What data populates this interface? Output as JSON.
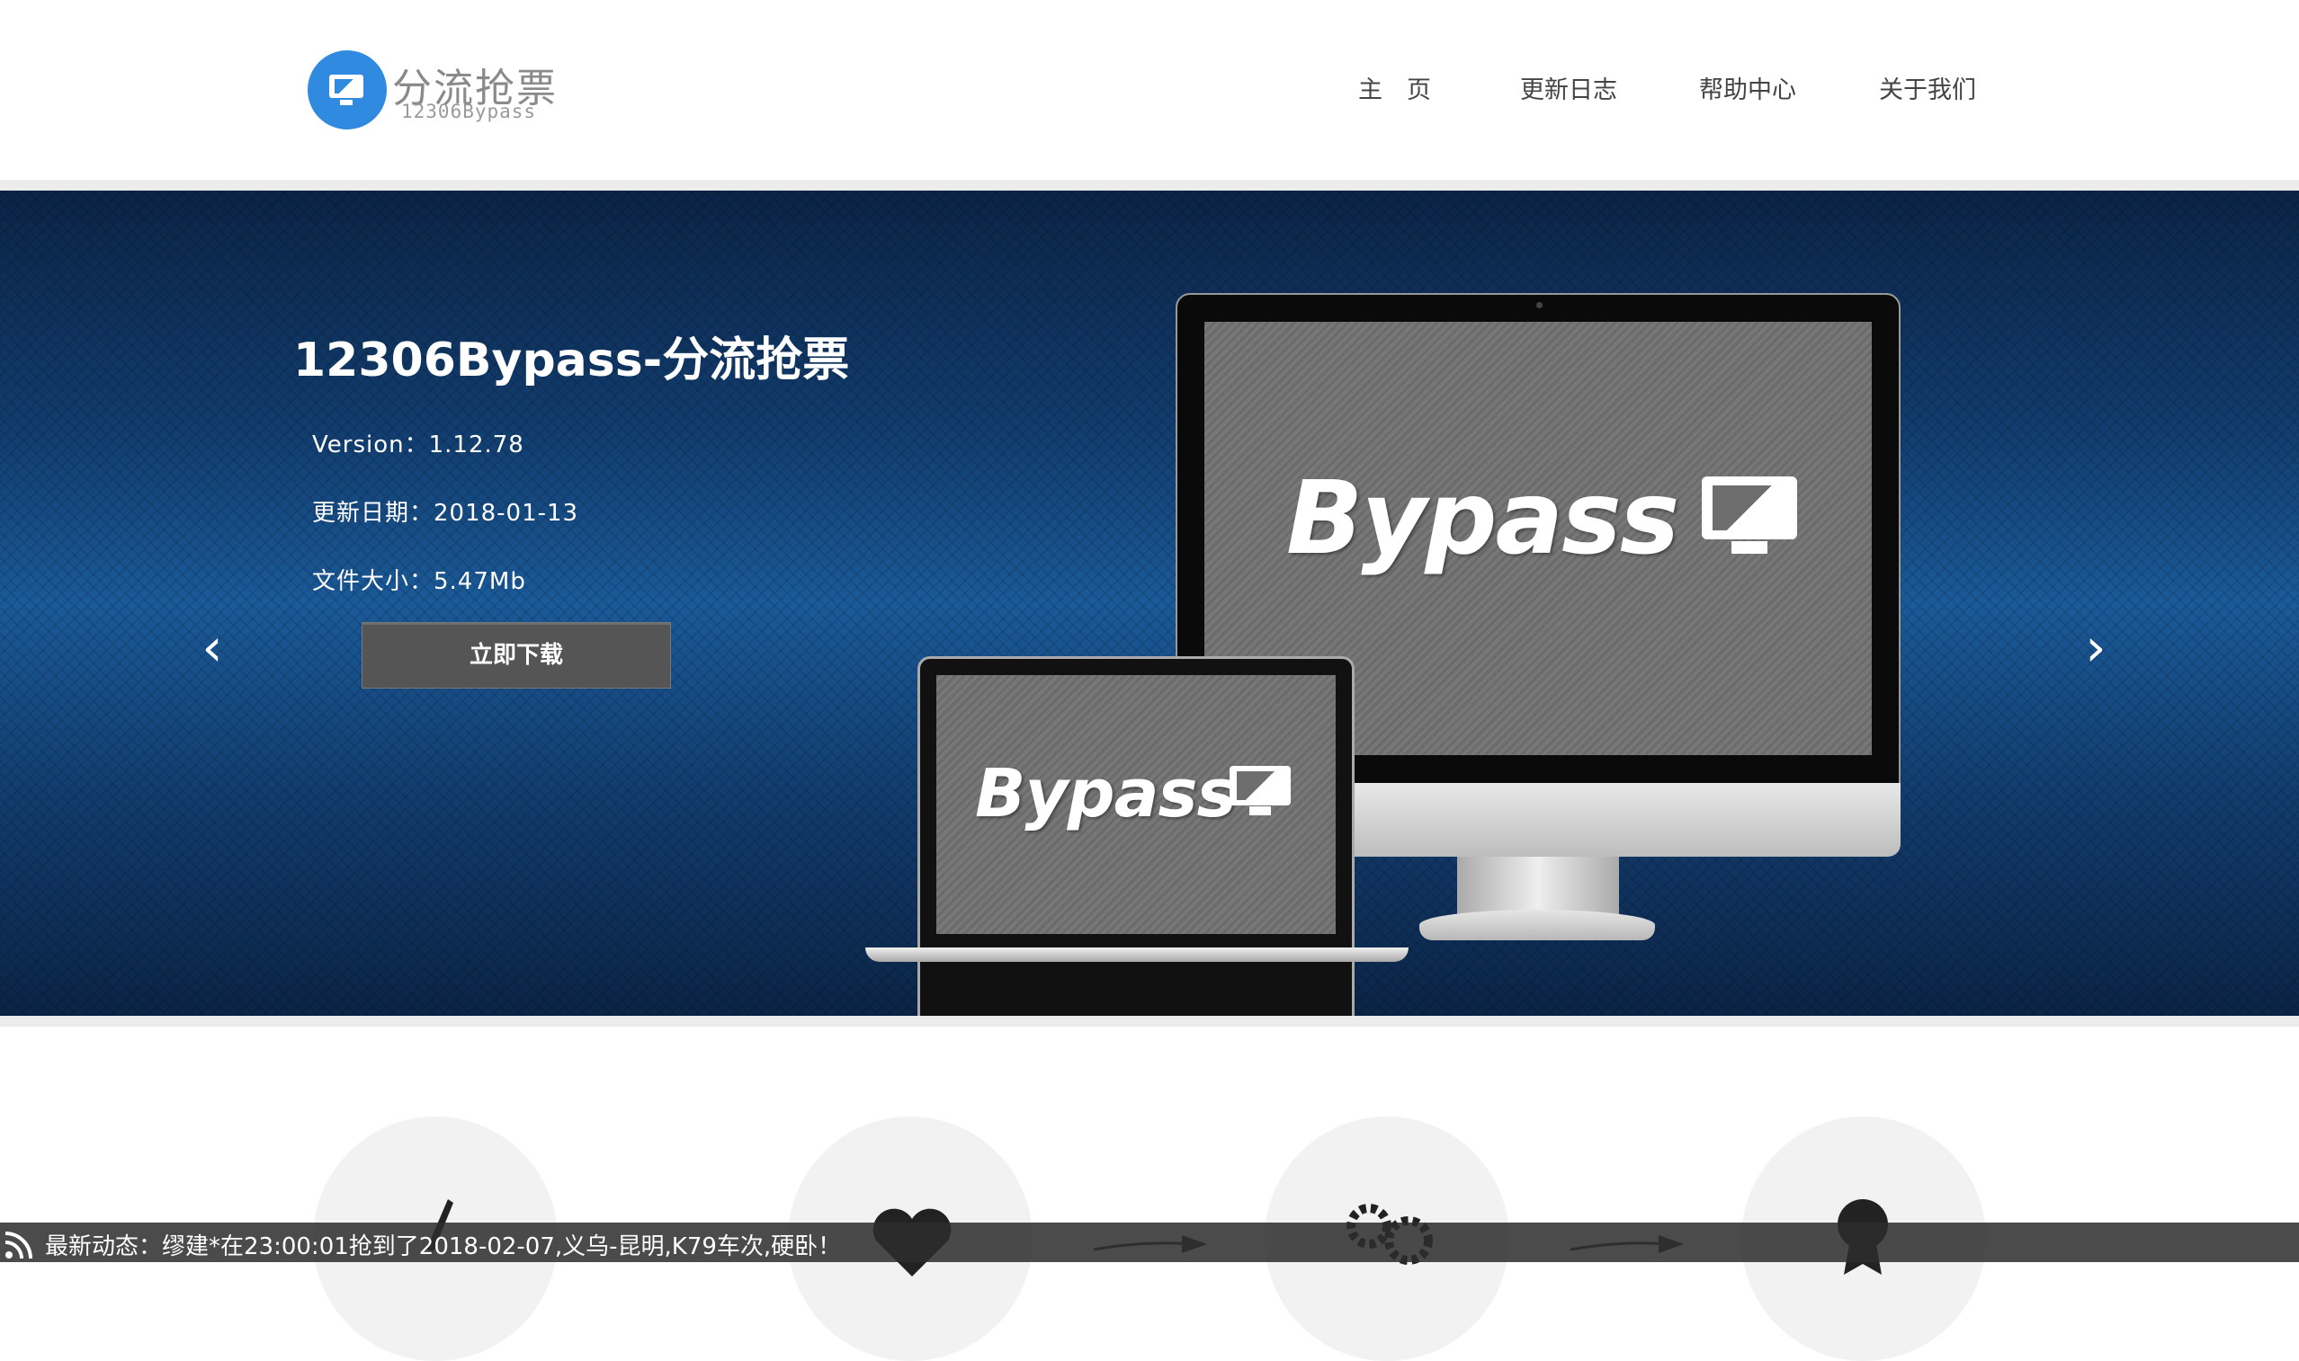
{
  "header": {
    "logo_title": "分流抢票",
    "logo_sub": "12306Bypass",
    "nav": [
      "主　页",
      "更新日志",
      "帮助中心",
      "关于我们"
    ]
  },
  "banner": {
    "title": "12306Bypass-分流抢票",
    "version": "Version：1.12.78",
    "date": "更新日期：2018-01-13",
    "size": "文件大小：5.47Mb",
    "download": "立即下载",
    "prev_arrow": "‹",
    "next_arrow": "›",
    "screen_text": "Bypass"
  },
  "ticker": {
    "text": "最新动态：缪建*在23:00:01抢到了2018-02-07,义乌-昆明,K79车次,硬卧！"
  },
  "colors": {
    "logo_blue": "#2f8ae0",
    "banner_blue": "#123e70",
    "button_gray": "#555555",
    "ticker_bg": "#2d2d2d"
  },
  "icons": [
    "rss-icon",
    "pencil-icon",
    "heart-icon",
    "gears-icon",
    "award-icon",
    "arrow-right-icon"
  ]
}
